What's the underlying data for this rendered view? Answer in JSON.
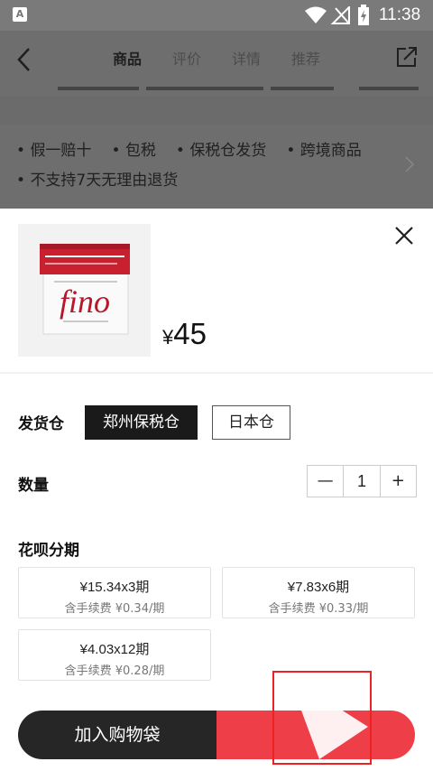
{
  "status_bar": {
    "time": "11:38",
    "app_badge": "A"
  },
  "header": {
    "tabs": [
      {
        "label": "商品",
        "active": true
      },
      {
        "label": "评价",
        "active": false
      },
      {
        "label": "详情",
        "active": false
      },
      {
        "label": "推荐",
        "active": false
      }
    ]
  },
  "services": {
    "line1": [
      "假一赔十",
      "包税",
      "保税仓发货",
      "跨境商品"
    ],
    "line2": [
      "不支持7天无理由退货"
    ]
  },
  "product": {
    "image_label": "fino",
    "currency": "¥",
    "price": "45"
  },
  "warehouse": {
    "label": "发货仓",
    "options": [
      {
        "label": "郑州保税仓",
        "selected": true
      },
      {
        "label": "日本仓",
        "selected": false
      }
    ]
  },
  "quantity": {
    "label": "数量",
    "minus": "—",
    "value": "1",
    "plus": "+"
  },
  "installments": {
    "label": "花呗分期",
    "plans": [
      {
        "amount": "¥15.34x3期",
        "fee": "含手续费 ¥0.34/期"
      },
      {
        "amount": "¥7.83x6期",
        "fee": "含手续费 ¥0.33/期"
      },
      {
        "amount": "¥4.03x12期",
        "fee": "含手续费 ¥0.28/期"
      }
    ]
  },
  "actions": {
    "add_to_cart": "加入购物袋"
  },
  "colors": {
    "accent": "#ee3e47",
    "dark": "#262626"
  }
}
